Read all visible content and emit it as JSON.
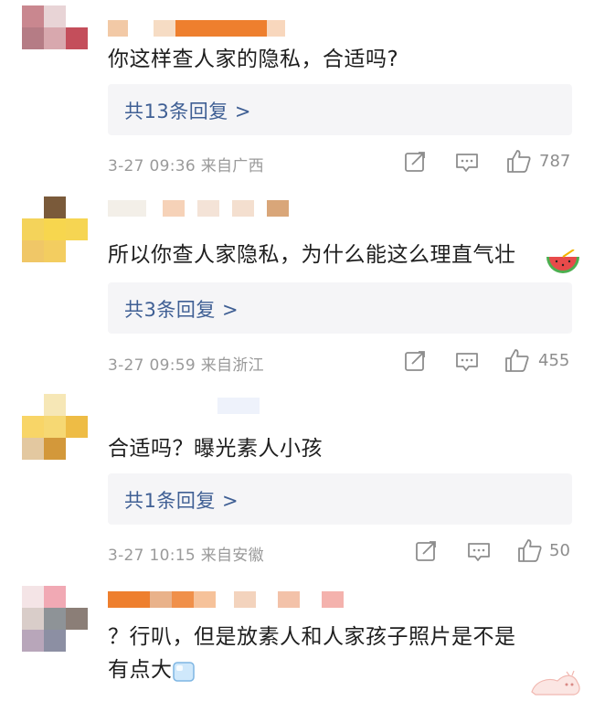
{
  "comments": [
    {
      "text": "你这样查人家的隐私，合适吗?",
      "replies": "共13条回复 >",
      "time": "3-27 09:36",
      "location": "来自广西",
      "likes": "787"
    },
    {
      "text": "所以你查人家隐私，为什么能这么理直气壮",
      "replies": "共3条回复 >",
      "time": "3-27 09:59",
      "location": "来自浙江",
      "likes": "455",
      "emoji": "watermelon-emoji"
    },
    {
      "text": "合适吗？曝光素人小孩",
      "replies": "共1条回复 >",
      "time": "3-27 10:15",
      "location": "来自安徽",
      "likes": "50"
    },
    {
      "text_line1": "？行叭，但是放素人和人家孩子照片是不是",
      "text_line2": "有点大",
      "emoji": "ice-cube-emoji",
      "watermark": "cat-watermark"
    }
  ],
  "icons": {
    "share": "share-icon",
    "comment": "comment-icon",
    "like": "thumbs-up-icon"
  },
  "colors": {
    "reply_link": "#3f5f94",
    "meta_text": "#9a9a9a",
    "reply_box_bg": "#f5f5f7"
  }
}
